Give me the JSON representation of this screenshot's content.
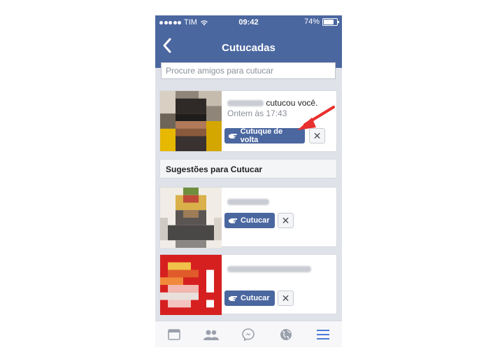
{
  "status_bar": {
    "carrier": "TIM",
    "time": "09:42",
    "battery": "74%"
  },
  "nav": {
    "title": "Cutucadas"
  },
  "search": {
    "placeholder": "Procure amigos para cutucar"
  },
  "poke": {
    "action_text": "cutucou você.",
    "time": "Ontem às 17:43",
    "button_label": "Cutuque de volta",
    "close_label": "✕"
  },
  "suggestions": {
    "header": "Sugestões para Cutucar",
    "items": [
      {
        "button_label": "Cutucar",
        "close_label": "✕"
      },
      {
        "button_label": "Cutucar",
        "close_label": "✕"
      }
    ]
  },
  "tabbar": {
    "icons": [
      "feed-icon",
      "friends-icon",
      "messenger-icon",
      "globe-icon",
      "menu-icon"
    ]
  },
  "colors": {
    "brand": "#4b67a0",
    "annotation_arrow": "#e8302e"
  }
}
